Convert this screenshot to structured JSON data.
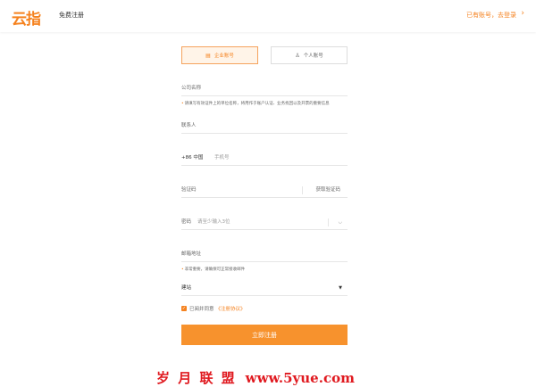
{
  "header": {
    "logo_text": "云指",
    "page_title": "免费注册",
    "login_link": "已有账号，去登录",
    "login_chevron": "›"
  },
  "tabs": [
    {
      "label": "企业账号",
      "icon": "building-icon",
      "active": true
    },
    {
      "label": "个人账号",
      "icon": "user-icon",
      "active": false
    }
  ],
  "form": {
    "company_label": "公司名称",
    "company_hint": "请填写有效证件上的单位名称，将用作于账户认证、业务找回以及开票的重要信息",
    "contact_label": "联系人",
    "phone_country": "+86 中国",
    "phone_placeholder": "手机号",
    "code_label": "验证码",
    "code_action": "获取验证码",
    "password_label": "密码",
    "password_placeholder": "请至少输入3位",
    "email_label": "邮箱地址",
    "email_hint": "非常重要，请确保可正常接收邮件",
    "site_label": "建站",
    "agree_text": "已阅并同意",
    "agree_link": "《注册协议》",
    "submit_label": "立即注册"
  },
  "watermark": {
    "text": "岁 月 联 盟",
    "url": "www.5yue.com"
  },
  "colors": {
    "accent": "#f5821f",
    "button": "#f7922d",
    "watermark": "#e0191f"
  }
}
